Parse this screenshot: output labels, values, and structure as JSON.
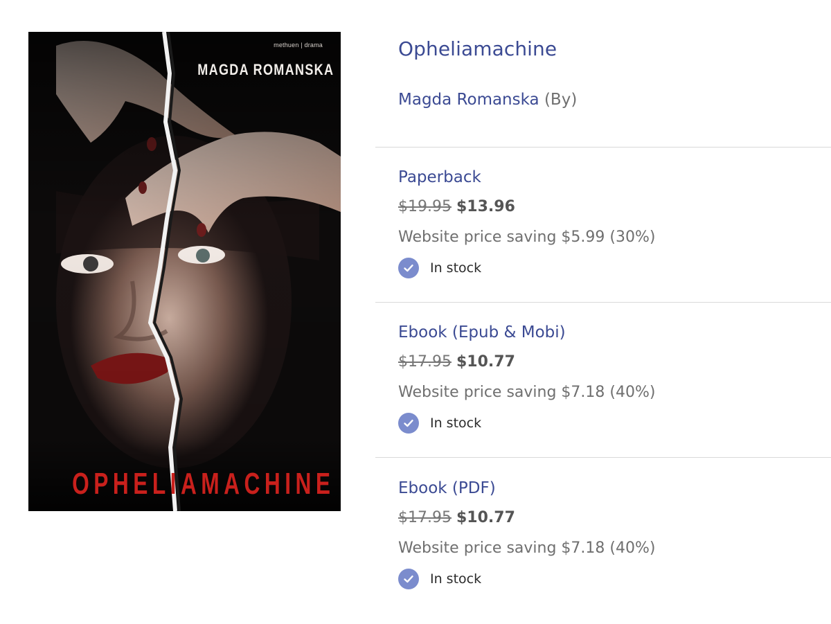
{
  "cover": {
    "publisher": "methuen | drama",
    "author": "MAGDA ROMANSKA",
    "title": "OPHELIAMACHINE"
  },
  "product": {
    "title": "Opheliamachine",
    "contributor_name": "Magda Romanska",
    "contributor_role": "(By)"
  },
  "formats": [
    {
      "name": "Paperback",
      "old_price": "$19.95",
      "new_price": "$13.96",
      "saving": "Website price saving $5.99 (30%)",
      "stock": "In stock"
    },
    {
      "name": "Ebook (Epub & Mobi)",
      "old_price": "$17.95",
      "new_price": "$10.77",
      "saving": "Website price saving $7.18 (40%)",
      "stock": "In stock"
    },
    {
      "name": "Ebook (PDF)",
      "old_price": "$17.95",
      "new_price": "$10.77",
      "saving": "Website price saving $7.18 (40%)",
      "stock": "In stock"
    }
  ],
  "colors": {
    "link": "#3b4a93",
    "check": "#7b8ccd",
    "cover_title": "#c9201c"
  },
  "icons": {
    "stock": "check-circle-icon"
  }
}
